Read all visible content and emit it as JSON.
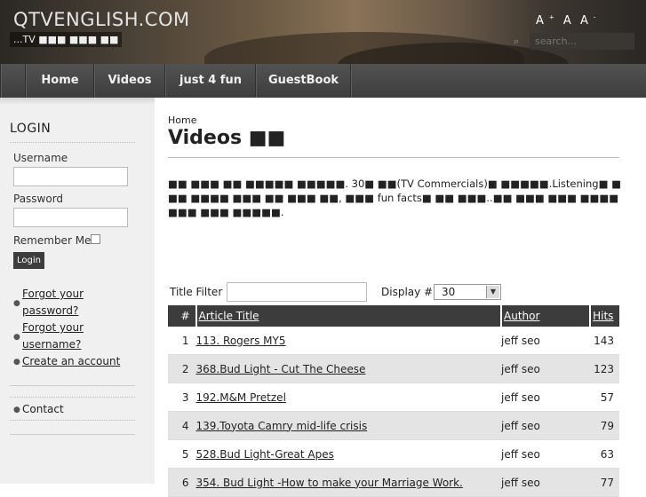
{
  "site": {
    "title": "QTVENGLISH.COM",
    "tagline": "...TV ■■■ ■■■ ■■",
    "font_sizer": [
      "A",
      "A",
      "A"
    ],
    "font_sizer_marks": [
      "+",
      "",
      "-"
    ],
    "search_placeholder": "search..."
  },
  "nav": {
    "items": [
      {
        "label": "Home"
      },
      {
        "label": "Videos"
      },
      {
        "label": "just 4 fun"
      },
      {
        "label": "GuestBook"
      }
    ]
  },
  "sidebar": {
    "login_title": "LOGIN",
    "username_label": "Username",
    "username_value": "",
    "password_label": "Password",
    "password_value": "",
    "remember_label": "Remember Me",
    "remember_checked": false,
    "login_button": "Login",
    "links": [
      {
        "text": "Forgot your password?"
      },
      {
        "text": "Forgot your username?"
      },
      {
        "text": "Create an account"
      }
    ],
    "contact_label": "Contact"
  },
  "main": {
    "breadcrumb": "Home",
    "page_title": "Videos ■■",
    "intro": "■■ ■■■ ■■ ■■■■■ ■■■■■. 30■ ■■(TV Commercials)■ ■■■■■.Listening■ ■ ■■ ■■■■ ■■■ ■■ ■■■ ■■, ■■■ fun facts■ ■■ ■■■..■■ ■■■ ■■■ ■■■■ ■■■ ■■■ ■■■■■.",
    "filter_label": "Title Filter",
    "filter_value": "",
    "display_label": "Display #",
    "display_value": "30",
    "columns": {
      "num": "#",
      "title": "Article Title",
      "author": "Author",
      "hits": "Hits"
    },
    "rows": [
      {
        "num": "1",
        "title": "113. Rogers MY5",
        "author": "jeff seo",
        "hits": "143"
      },
      {
        "num": "2",
        "title": "368.Bud Light - Cut The Cheese",
        "author": "jeff seo",
        "hits": "123"
      },
      {
        "num": "3",
        "title": "192.M&M Pretzel",
        "author": "jeff seo",
        "hits": "57"
      },
      {
        "num": "4",
        "title": "139.Toyota Camry mid-life crisis",
        "author": "jeff seo",
        "hits": "79"
      },
      {
        "num": "5",
        "title": "528.Bud Light-Great Apes",
        "author": "jeff seo",
        "hits": "63"
      },
      {
        "num": "6",
        "title": "354. Bud Light -How to make your Marriage Work.",
        "author": "jeff seo",
        "hits": "77"
      }
    ]
  }
}
